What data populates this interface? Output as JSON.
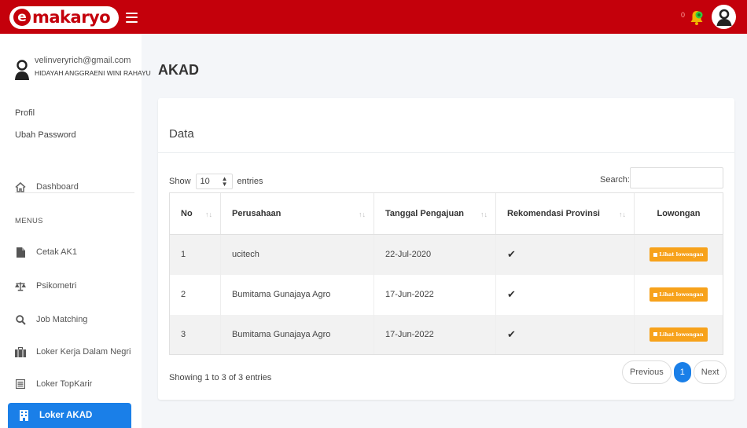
{
  "brand": {
    "logo_letter": "e",
    "logo_text": "makaryo"
  },
  "topbar": {
    "notification_count": "0"
  },
  "user": {
    "email": "velinveryrich@gmail.com",
    "name": "HIDAYAH ANGGRAENI WINI RAHAYU"
  },
  "account_links": [
    {
      "label": "Profil"
    },
    {
      "label": "Ubah Password"
    }
  ],
  "nav": {
    "dashboard": {
      "label": "Dashboard",
      "icon": "home-icon"
    },
    "menus_label": "MENUS",
    "items": [
      {
        "label": "Cetak AK1",
        "icon": "file-icon"
      },
      {
        "label": "Psikometri",
        "icon": "balance-scale-icon"
      },
      {
        "label": "Job Matching",
        "icon": "search-icon"
      },
      {
        "label": "Loker Kerja Dalam Negri",
        "icon": "briefcase-icon"
      },
      {
        "label": "Loker TopKarir",
        "icon": "list-icon"
      }
    ],
    "active": {
      "label": "Loker AKAD",
      "icon": "building-icon"
    }
  },
  "page": {
    "title": "AKAD"
  },
  "card": {
    "title": "Data",
    "show_label": "Show",
    "entries_label": "entries",
    "page_length": "10",
    "search_label": "Search:",
    "search_value": ""
  },
  "table": {
    "columns": [
      "No",
      "Perusahaan",
      "Tanggal Pengajuan",
      "Rekomendasi Provinsi",
      "Lowongan"
    ],
    "rows": [
      {
        "no": "1",
        "perusahaan": "ucitech",
        "tanggal": "22-Jul-2020",
        "rekomendasi": "✔",
        "button": "Lihat lowongan"
      },
      {
        "no": "2",
        "perusahaan": "Bumitama Gunajaya Agro",
        "tanggal": "17-Jun-2022",
        "rekomendasi": "✔",
        "button": "Lihat lowongan"
      },
      {
        "no": "3",
        "perusahaan": "Bumitama Gunajaya Agro",
        "tanggal": "17-Jun-2022",
        "rekomendasi": "✔",
        "button": "Lihat lowongan"
      }
    ]
  },
  "footer": {
    "info": "Showing 1 to 3 of 3 entries",
    "previous": "Previous",
    "current_page": "1",
    "next": "Next"
  },
  "colors": {
    "topbar": "#c4000b",
    "active": "#1a7fe8",
    "button": "#f7a21b"
  }
}
